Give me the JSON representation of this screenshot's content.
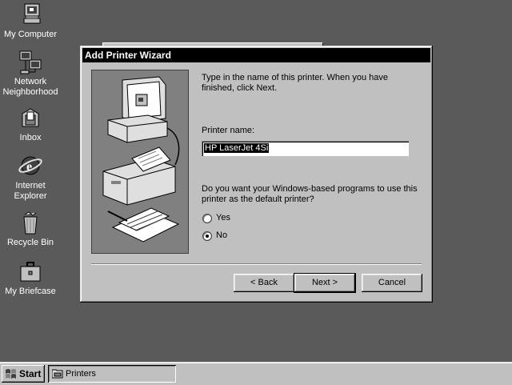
{
  "desktop": {
    "icons": [
      {
        "label": "My Computer",
        "icon": "my-computer-icon"
      },
      {
        "label": "Network Neighborhood",
        "icon": "network-neighborhood-icon"
      },
      {
        "label": "Inbox",
        "icon": "inbox-icon"
      },
      {
        "label": "Internet Explorer",
        "icon": "internet-explorer-icon"
      },
      {
        "label": "Recycle Bin",
        "icon": "recycle-bin-icon"
      },
      {
        "label": "My Briefcase",
        "icon": "briefcase-icon"
      }
    ]
  },
  "dialog": {
    "title": "Add Printer Wizard",
    "instructions": "Type in the name of this printer.  When you have finished, click Next.",
    "printer_name_label": "Printer name:",
    "printer_name_value": "HP LaserJet 4Si",
    "default_question": "Do you want your Windows-based programs to use this printer as the default printer?",
    "options": [
      {
        "label": "Yes",
        "checked": false
      },
      {
        "label": "No",
        "checked": true
      }
    ],
    "buttons": {
      "back": "< Back",
      "next": "Next >",
      "cancel": "Cancel"
    }
  },
  "taskbar": {
    "start_label": "Start",
    "tasks": [
      {
        "label": "Printers",
        "icon": "printers-folder-icon"
      }
    ]
  },
  "colors": {
    "desktop": "#5a5a5a",
    "face": "#c0c0c0",
    "titlebar": "#000000"
  }
}
